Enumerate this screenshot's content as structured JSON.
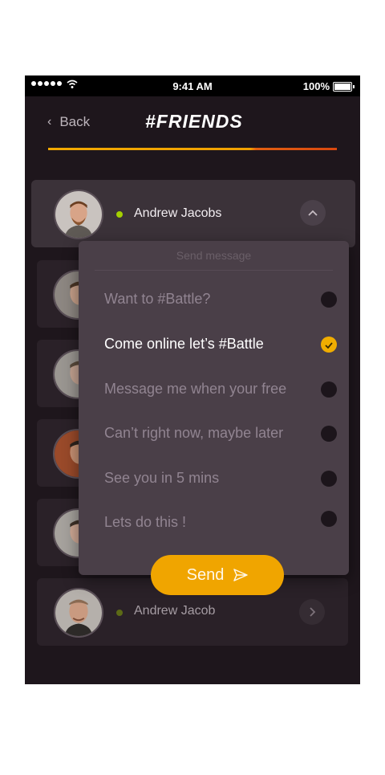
{
  "status_bar": {
    "time": "9:41 AM",
    "battery": "100%"
  },
  "nav": {
    "back_label": "Back",
    "title": "#FRIENDS"
  },
  "friends": [
    {
      "name": "Andrew Jacobs",
      "online_color": "#a4d000"
    },
    {
      "name": "Andrew Jacob",
      "online_color": "#5c6a16"
    }
  ],
  "dropdown": {
    "header": "Send message",
    "options": [
      {
        "label": "Want to #Battle?",
        "selected": false
      },
      {
        "label": "Come online let’s #Battle",
        "selected": true
      },
      {
        "label": "Message me when your free",
        "selected": false
      },
      {
        "label": "Can’t right now, maybe later",
        "selected": false
      },
      {
        "label": "See you in 5 mins",
        "selected": false
      },
      {
        "label": "Lets do this !",
        "selected": false
      }
    ],
    "send_label": "Send"
  },
  "icons": {
    "back": "chevron-left-icon",
    "collapse": "chevron-up-icon",
    "expand": "chevron-right-icon",
    "send": "paper-plane-icon",
    "check": "checkmark-icon"
  },
  "colors": {
    "accent": "#f0a500",
    "background": "#1e161c",
    "card": "#2a2128",
    "menu": "#4a3f48"
  }
}
